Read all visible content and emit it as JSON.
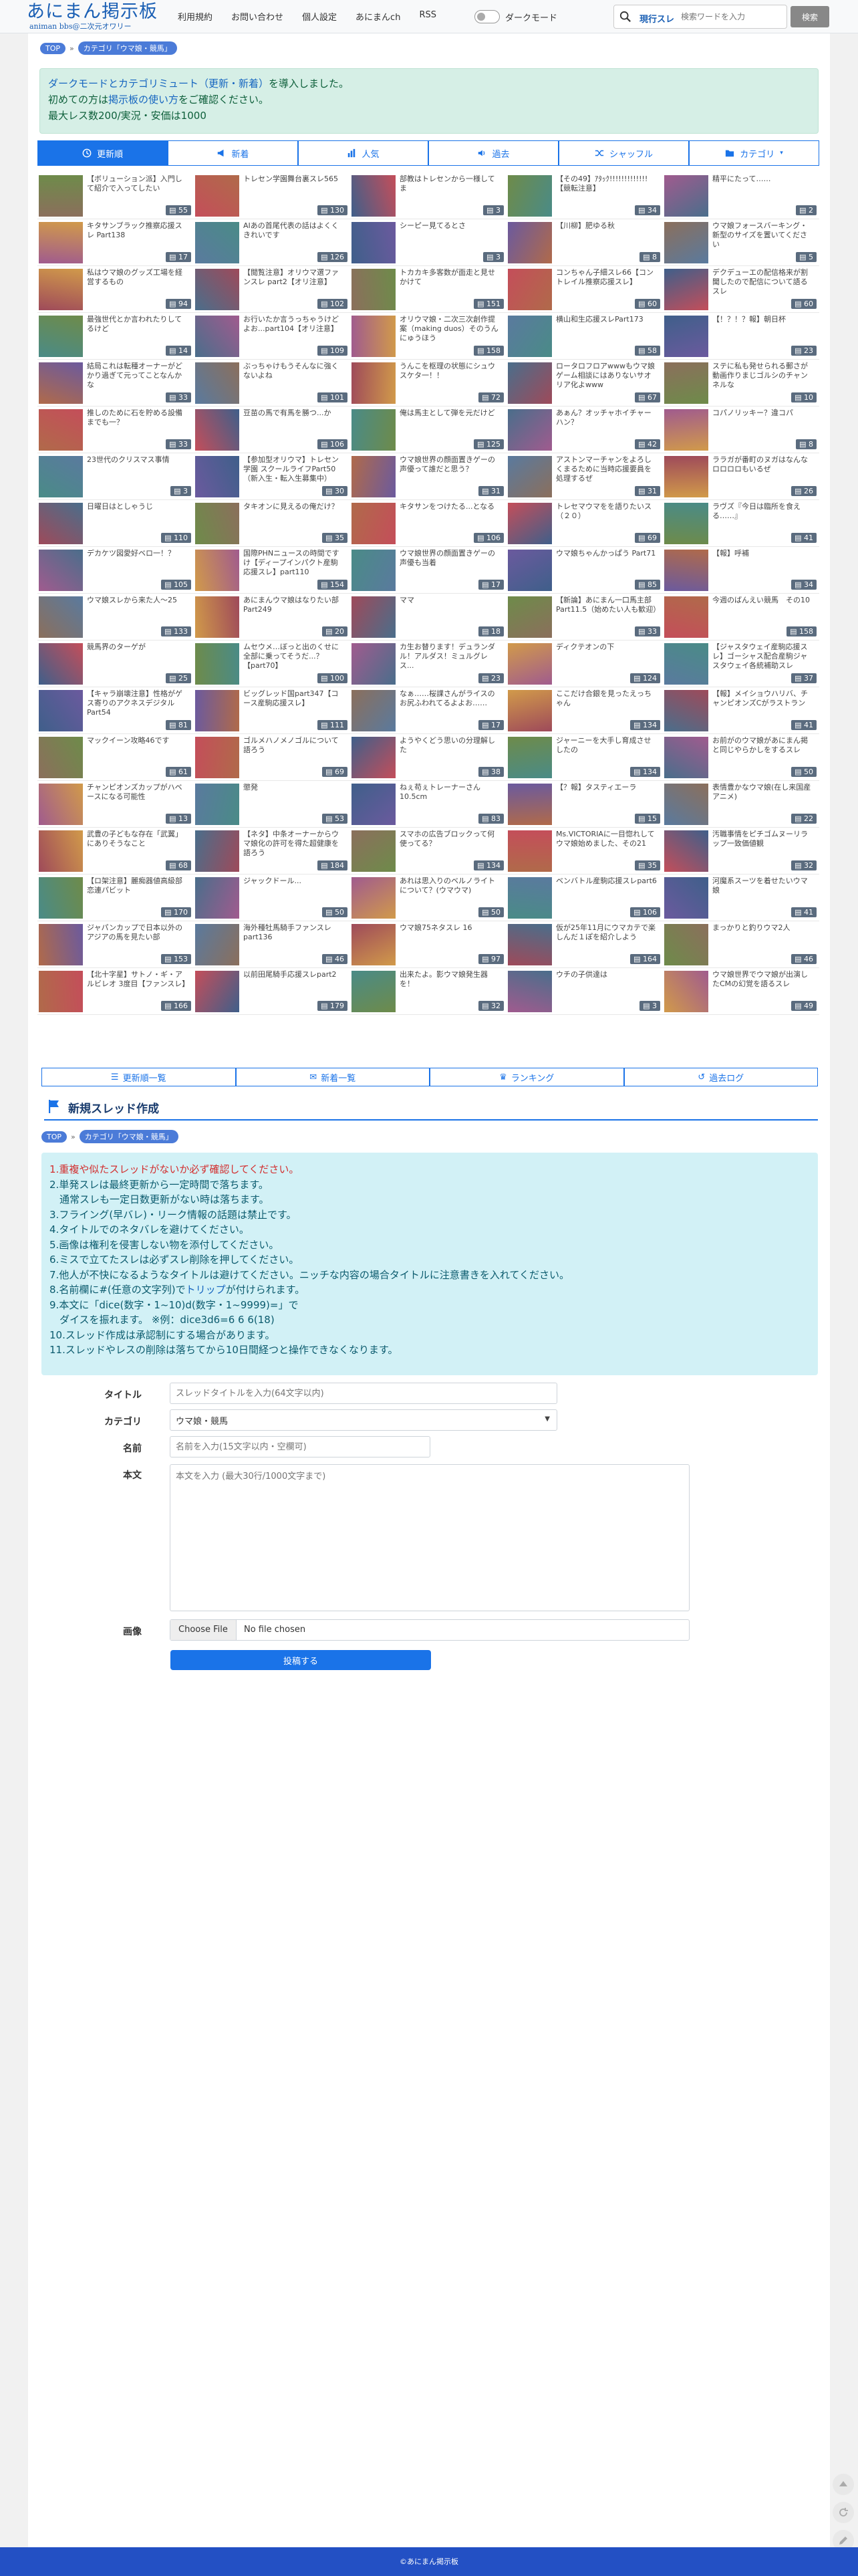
{
  "brand": {
    "title": "あにまん掲示板",
    "subtitle": "animan bbs@二次元オワリー"
  },
  "menu": [
    "利用規約",
    "お問い合わせ",
    "個人設定",
    "あにまんch",
    "RSS"
  ],
  "dark_mode_label": "ダークモード",
  "search": {
    "scope": "現行スレ",
    "placeholder": "検索ワードを入力",
    "button": "検索"
  },
  "breadcrumb": {
    "top": "TOP",
    "separator": "»",
    "category": "カテゴリ「ウマ娘・競馬」"
  },
  "notice": {
    "line1_link": "ダークモードとカテゴリミュート（更新・新着）",
    "line1_rest": "を導入しました。",
    "line2_pre": "初めての方は",
    "line2_link": "掲示板の使い方",
    "line2_post": "をご確認ください。",
    "line3": "最大レス数200/実況・安価は1000"
  },
  "tabs": [
    {
      "label": "更新順",
      "icon": "clock-icon"
    },
    {
      "label": "新着",
      "icon": "megaphone-icon"
    },
    {
      "label": "人気",
      "icon": "bar-chart-icon"
    },
    {
      "label": "過去",
      "icon": "volume-icon"
    },
    {
      "label": "シャッフル",
      "icon": "shuffle-icon"
    },
    {
      "label": "カテゴリ",
      "icon": "folder-icon"
    }
  ],
  "threads": [
    {
      "t": "【ボリューション派】入門し て紹介で入ってしたい",
      "c": "55"
    },
    {
      "t": "トレセン学園舞台裏スレ565",
      "c": "130"
    },
    {
      "t": "部教はトレセンから一様してま",
      "c": "3"
    },
    {
      "t": "【その49】ｱﾀｯｸ!!!!!!!!!!!!!【競転注意】",
      "c": "34"
    },
    {
      "t": "精平にたって……",
      "c": "2"
    },
    {
      "t": "キタサンブラック推察応援スレ Part138",
      "c": "17"
    },
    {
      "t": "AIあの首尾代表の話はよくくきれいです",
      "c": "126"
    },
    {
      "t": "シーピー見てるとさ",
      "c": "3"
    },
    {
      "t": "【川柳】肥ゆる秋",
      "c": "8"
    },
    {
      "t": "ウマ娘フォースバーキング・新型のサイズを置いてください",
      "c": "5"
    },
    {
      "t": "私はウマ娘のグッズ工場を経営するもの",
      "c": "94"
    },
    {
      "t": "【閲覧注意】オリウマ選ファンスレ part2【オリ注意】",
      "c": "102"
    },
    {
      "t": "トカカキ多客数が面走と見せかけて",
      "c": "151"
    },
    {
      "t": "コンちゃん子細スレ66【コントレイル推察応援スレ】",
      "c": "60"
    },
    {
      "t": "デクデューエの配信格来が割聞したので配信について語るスレ",
      "c": "60"
    },
    {
      "t": "最強世代とか言われたりしてるけど",
      "c": "14"
    },
    {
      "t": "お行いたか言うっちゃうけどよお...part104【オリ注意】",
      "c": "109"
    },
    {
      "t": "オリウマ娘・二次三次創作提案（making duos）そのうんにゅうほう",
      "c": "158"
    },
    {
      "t": "横山和生応援スレPart173",
      "c": "58"
    },
    {
      "t": "【！？！？報】朝日杯",
      "c": "23"
    },
    {
      "t": "結局これは転種オーナーがどかり過ぎて元ってことなんかな",
      "c": "33"
    },
    {
      "t": "ぶっちゃけもうそんなに強くないよね",
      "c": "101"
    },
    {
      "t": "うんこを枢理の状態にシュウスケタ一！！",
      "c": "72"
    },
    {
      "t": "ロータロフロアwwwもウマ娘ゲーム相談にはありないサオリア化よwww",
      "c": "67"
    },
    {
      "t": "ステに私も発せられる郵さが動画作りまじゴルシのチャンネルな",
      "c": "10"
    },
    {
      "t": "推しのために石を貯める設備までも一？",
      "c": "33"
    },
    {
      "t": "豆苗の馬で有馬を勝つ...か",
      "c": "106"
    },
    {
      "t": "俺は馬主として弾を元だけど",
      "c": "125"
    },
    {
      "t": "あぁん？オッチャホイチャーハン？",
      "c": "42"
    },
    {
      "t": "コパノリッキー？違コパ",
      "c": "8"
    },
    {
      "t": "23世代のクリスマス事情",
      "c": "3"
    },
    {
      "t": "【参加型オリウマ】トレセン学園 スクールライフPart50（新入生・転入生募集中）",
      "c": "30"
    },
    {
      "t": "ウマ娘世界の顔面置きゲーの声優って誰だと思う？",
      "c": "31"
    },
    {
      "t": "アストンマーチャンをよろしくまるために当時応援要員を処理するぜ",
      "c": "31"
    },
    {
      "t": "ララガが番町のヌガはなんなロロロロもいるぜ",
      "c": "26"
    },
    {
      "t": "日曜日はとしゃうじ",
      "c": "110"
    },
    {
      "t": "タキオンに見えるの俺だけ？",
      "c": "35"
    },
    {
      "t": "キタサンをつけたる...となる",
      "c": "106"
    },
    {
      "t": "トレセマウマをを語りたいス（２０）",
      "c": "69"
    },
    {
      "t": "ラヴズ『今日は臨所を食える……』",
      "c": "41"
    },
    {
      "t": "デカケツ図愛好ベロ一！？",
      "c": "105"
    },
    {
      "t": "国際PHNニュースの時間ですけ【ディープインパクト産駒応援スレ】part110",
      "c": "154"
    },
    {
      "t": "ウマ娘世界の顔面置きゲーの声優も当着",
      "c": "17"
    },
    {
      "t": "ウマ娘ちゃんかっぱう Part71",
      "c": "85"
    },
    {
      "t": "【報】呼補",
      "c": "34"
    },
    {
      "t": "ウマ娘スレから来た人～25",
      "c": "133"
    },
    {
      "t": "あにまんウマ娘はなりたい部Part249",
      "c": "20"
    },
    {
      "t": "ママ",
      "c": "18"
    },
    {
      "t": "【新論】あにまん一口馬主部Part11.5（始めたい人も歓迎）",
      "c": "33"
    },
    {
      "t": "今週のばんえい競馬　その10",
      "c": "158"
    },
    {
      "t": "競馬界のターゲが",
      "c": "25"
    },
    {
      "t": "ムセウメ…ぼっと出のくせに全部に乗ってそうだ...？【part70】",
      "c": "100"
    },
    {
      "t": "カ生お替ります！デュランダル！アルダス！ミュルグレス...",
      "c": "23"
    },
    {
      "t": "ディクテオンの下",
      "c": "124"
    },
    {
      "t": "【ジャスタウェイ産駒応援スレ】ゴーシャス配合産駒ジャスタウェイ各統補助スレ",
      "c": "37"
    },
    {
      "t": "【キャラ崩壊注意】性格がゲス寄りのアクネスデジタル Part54",
      "c": "81"
    },
    {
      "t": "ビッグレッド国part347【コース産駒応援スレ】",
      "c": "111"
    },
    {
      "t": "なぁ……桜課さんがライスのお尻ふわれてるよよお……",
      "c": "17"
    },
    {
      "t": "ここだけ合銀を見ったえっちゃん",
      "c": "134"
    },
    {
      "t": "【報】メイショウハリバ、チャンピオンズCがラストラン",
      "c": "41"
    },
    {
      "t": "マックイーン攻略46です",
      "c": "61"
    },
    {
      "t": "ゴルメハノメノゴルについて語ろう",
      "c": "69"
    },
    {
      "t": "ようやくどう思いの分理解した",
      "c": "38"
    },
    {
      "t": "ジャーニーを大手し育成させしたの",
      "c": "134"
    },
    {
      "t": "お前がのウマ娘があにまん掲と同じやらかしをするスレ",
      "c": "50"
    },
    {
      "t": "チャンピオンズカップがハベースになる可能性",
      "c": "13"
    },
    {
      "t": "懲発",
      "c": "53"
    },
    {
      "t": "ねぇ苟ぇトレーナーさん　10.5cm",
      "c": "83"
    },
    {
      "t": "【？報】タスティエーラ",
      "c": "15"
    },
    {
      "t": "表情豊かなウマ娘(在し来国産アニメ)",
      "c": "22"
    },
    {
      "t": "武豊の子どもな存在「武翼」にありそうなこと",
      "c": "68"
    },
    {
      "t": "【ネタ】中条オーナーからウマ娘化の許可を得た超健康を語ろう",
      "c": "184"
    },
    {
      "t": "スマホの広告ブロックって何使ってる？",
      "c": "134"
    },
    {
      "t": "Ms.VICTORIAに一目惚れしてウマ娘始めました、その21",
      "c": "35"
    },
    {
      "t": "汚職事情をピチゴムヌーリラップ一致価値観",
      "c": "32"
    },
    {
      "t": "【ロ架注意】麗痴器値高級部恋連パビット",
      "c": "170"
    },
    {
      "t": "ジャックドール...",
      "c": "50"
    },
    {
      "t": "あれは思入りのベルノライトについて？(ウマウマ)",
      "c": "50"
    },
    {
      "t": "ベンバトル産駒応援スレpart6",
      "c": "106"
    },
    {
      "t": "河魔系スーツを着せたいウマ娘",
      "c": "41"
    },
    {
      "t": "ジャパンカップで日本以外のアジアの馬を見たい部",
      "c": "153"
    },
    {
      "t": "海外種牡馬騎手ファンスレpart136",
      "c": "46"
    },
    {
      "t": "ウマ娘75ネタスレ 16",
      "c": "97"
    },
    {
      "t": "仮が25年11月にウマカテで楽しんだ１ぽを紹介しよう",
      "c": "164"
    },
    {
      "t": "まっかりと釣りウマ2人",
      "c": "46"
    },
    {
      "t": "【北十字星】サトノ・ギ・アルビレオ 3度目【ファンスレ】",
      "c": "166"
    },
    {
      "t": "以前田尾騎手応援スレpart2",
      "c": "179"
    },
    {
      "t": "出来たよ。影ウマ娘発生器を！",
      "c": "32"
    },
    {
      "t": "ウチの子供達は",
      "c": "3"
    },
    {
      "t": "ウマ娘世界でウマ娘が出演したCMの幻覚を語るスレ",
      "c": "49"
    }
  ],
  "bottom_nav": [
    {
      "label": "更新順一覧",
      "icon": "list-icon"
    },
    {
      "label": "新着一覧",
      "icon": "megaphone-icon"
    },
    {
      "label": "ランキング",
      "icon": "trophy-icon"
    },
    {
      "label": "過去ログ",
      "icon": "history-icon"
    }
  ],
  "new_thread": {
    "heading": "新規スレッド作成",
    "icon": "flag-icon"
  },
  "rules": [
    {
      "n": "1.",
      "t": "重複や似たスレッドがないか必ず確認してください。",
      "red": true
    },
    {
      "n": "2.",
      "t": "単発スレは最終更新から一定時間で落ちます。"
    },
    {
      "n": "",
      "t": "　通常スレも一定日数更新がない時は落ちます。"
    },
    {
      "n": "3.",
      "t": "フライング(早バレ)・リーク情報の話題は禁止です。"
    },
    {
      "n": "4.",
      "t": "タイトルでのネタバレを避けてください。"
    },
    {
      "n": "5.",
      "t": "画像は権利を侵害しない物を添付してください。"
    },
    {
      "n": "6.",
      "t": "ミスで立てたスレは必ずスレ削除を押してください。"
    },
    {
      "n": "7.",
      "t": "他人が不快になるようなタイトルは避けてください。ニッチな内容の場合タイトルに注意書きを入れてください。"
    },
    {
      "n": "8.",
      "t": "名前欄に#(任意の文字列)で",
      "link": "トリップ",
      "post": "が付けられます。"
    },
    {
      "n": "9.",
      "t": "本文に「dice(数字・1~10)d(数字・1~9999)=」で"
    },
    {
      "n": "",
      "t": "　ダイスを振れます。 ※例：dice3d6=6 6 6(18)"
    },
    {
      "n": "10.",
      "t": "スレッド作成は承認制にする場合があります。"
    },
    {
      "n": "11.",
      "t": "スレッドやレスの削除は落ちてから10日間経つと操作できなくなります。"
    }
  ],
  "form": {
    "title_label": "タイトル",
    "title_placeholder": "スレッドタイトルを入力(64文字以内)",
    "category_label": "カテゴリ",
    "category_value": "ウマ娘・競馬",
    "name_label": "名前",
    "name_placeholder": "名前を入力(15文字以内・空欄可)",
    "body_label": "本文",
    "body_placeholder": "本文を入力 (最大30行/1000文字まで)",
    "image_label": "画像",
    "file_button": "Choose File",
    "file_status": "No file chosen",
    "submit": "投稿する"
  },
  "footer": "©あにまん掲示板"
}
